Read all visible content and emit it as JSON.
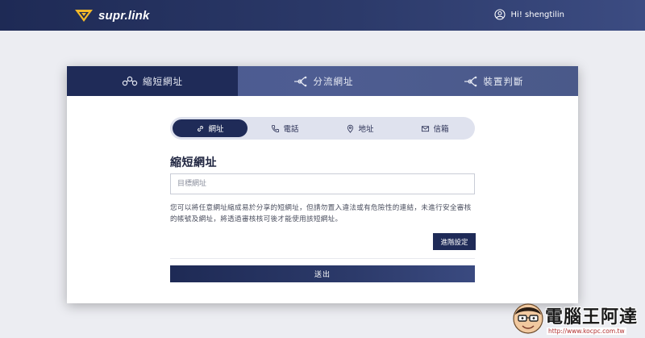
{
  "header": {
    "logo_text": "supr.link",
    "user_greeting": "Hi! shengtilin"
  },
  "card_tabs": [
    {
      "label": "縮短網址",
      "icon": "link-chain-icon",
      "active": true
    },
    {
      "label": "分流網址",
      "icon": "split-icon",
      "active": false
    },
    {
      "label": "裝置判斷",
      "icon": "device-icon",
      "active": false
    }
  ],
  "type_pills": [
    {
      "label": "網址",
      "icon": "link-icon",
      "active": true
    },
    {
      "label": "電話",
      "icon": "phone-icon",
      "active": false
    },
    {
      "label": "地址",
      "icon": "location-pin-icon",
      "active": false
    },
    {
      "label": "信箱",
      "icon": "mail-icon",
      "active": false
    }
  ],
  "form": {
    "title": "縮短網址",
    "target_placeholder": "目標網址",
    "target_value": "",
    "description": "您可以將任意網址縮成易於分享的短網址，但請勿置入違法或有危險性的連結，未進行安全審核的帳號及網址，將透過審核核可後才能使用該短網址。",
    "advanced_label": "進階設定",
    "submit_label": "送出"
  },
  "watermark": {
    "title": "電腦王阿達",
    "url": "http://www.kocpc.com.tw"
  },
  "colors": {
    "navy": "#1f2b58",
    "tab_blue": "#4a5a90",
    "background": "#ecedf2"
  }
}
